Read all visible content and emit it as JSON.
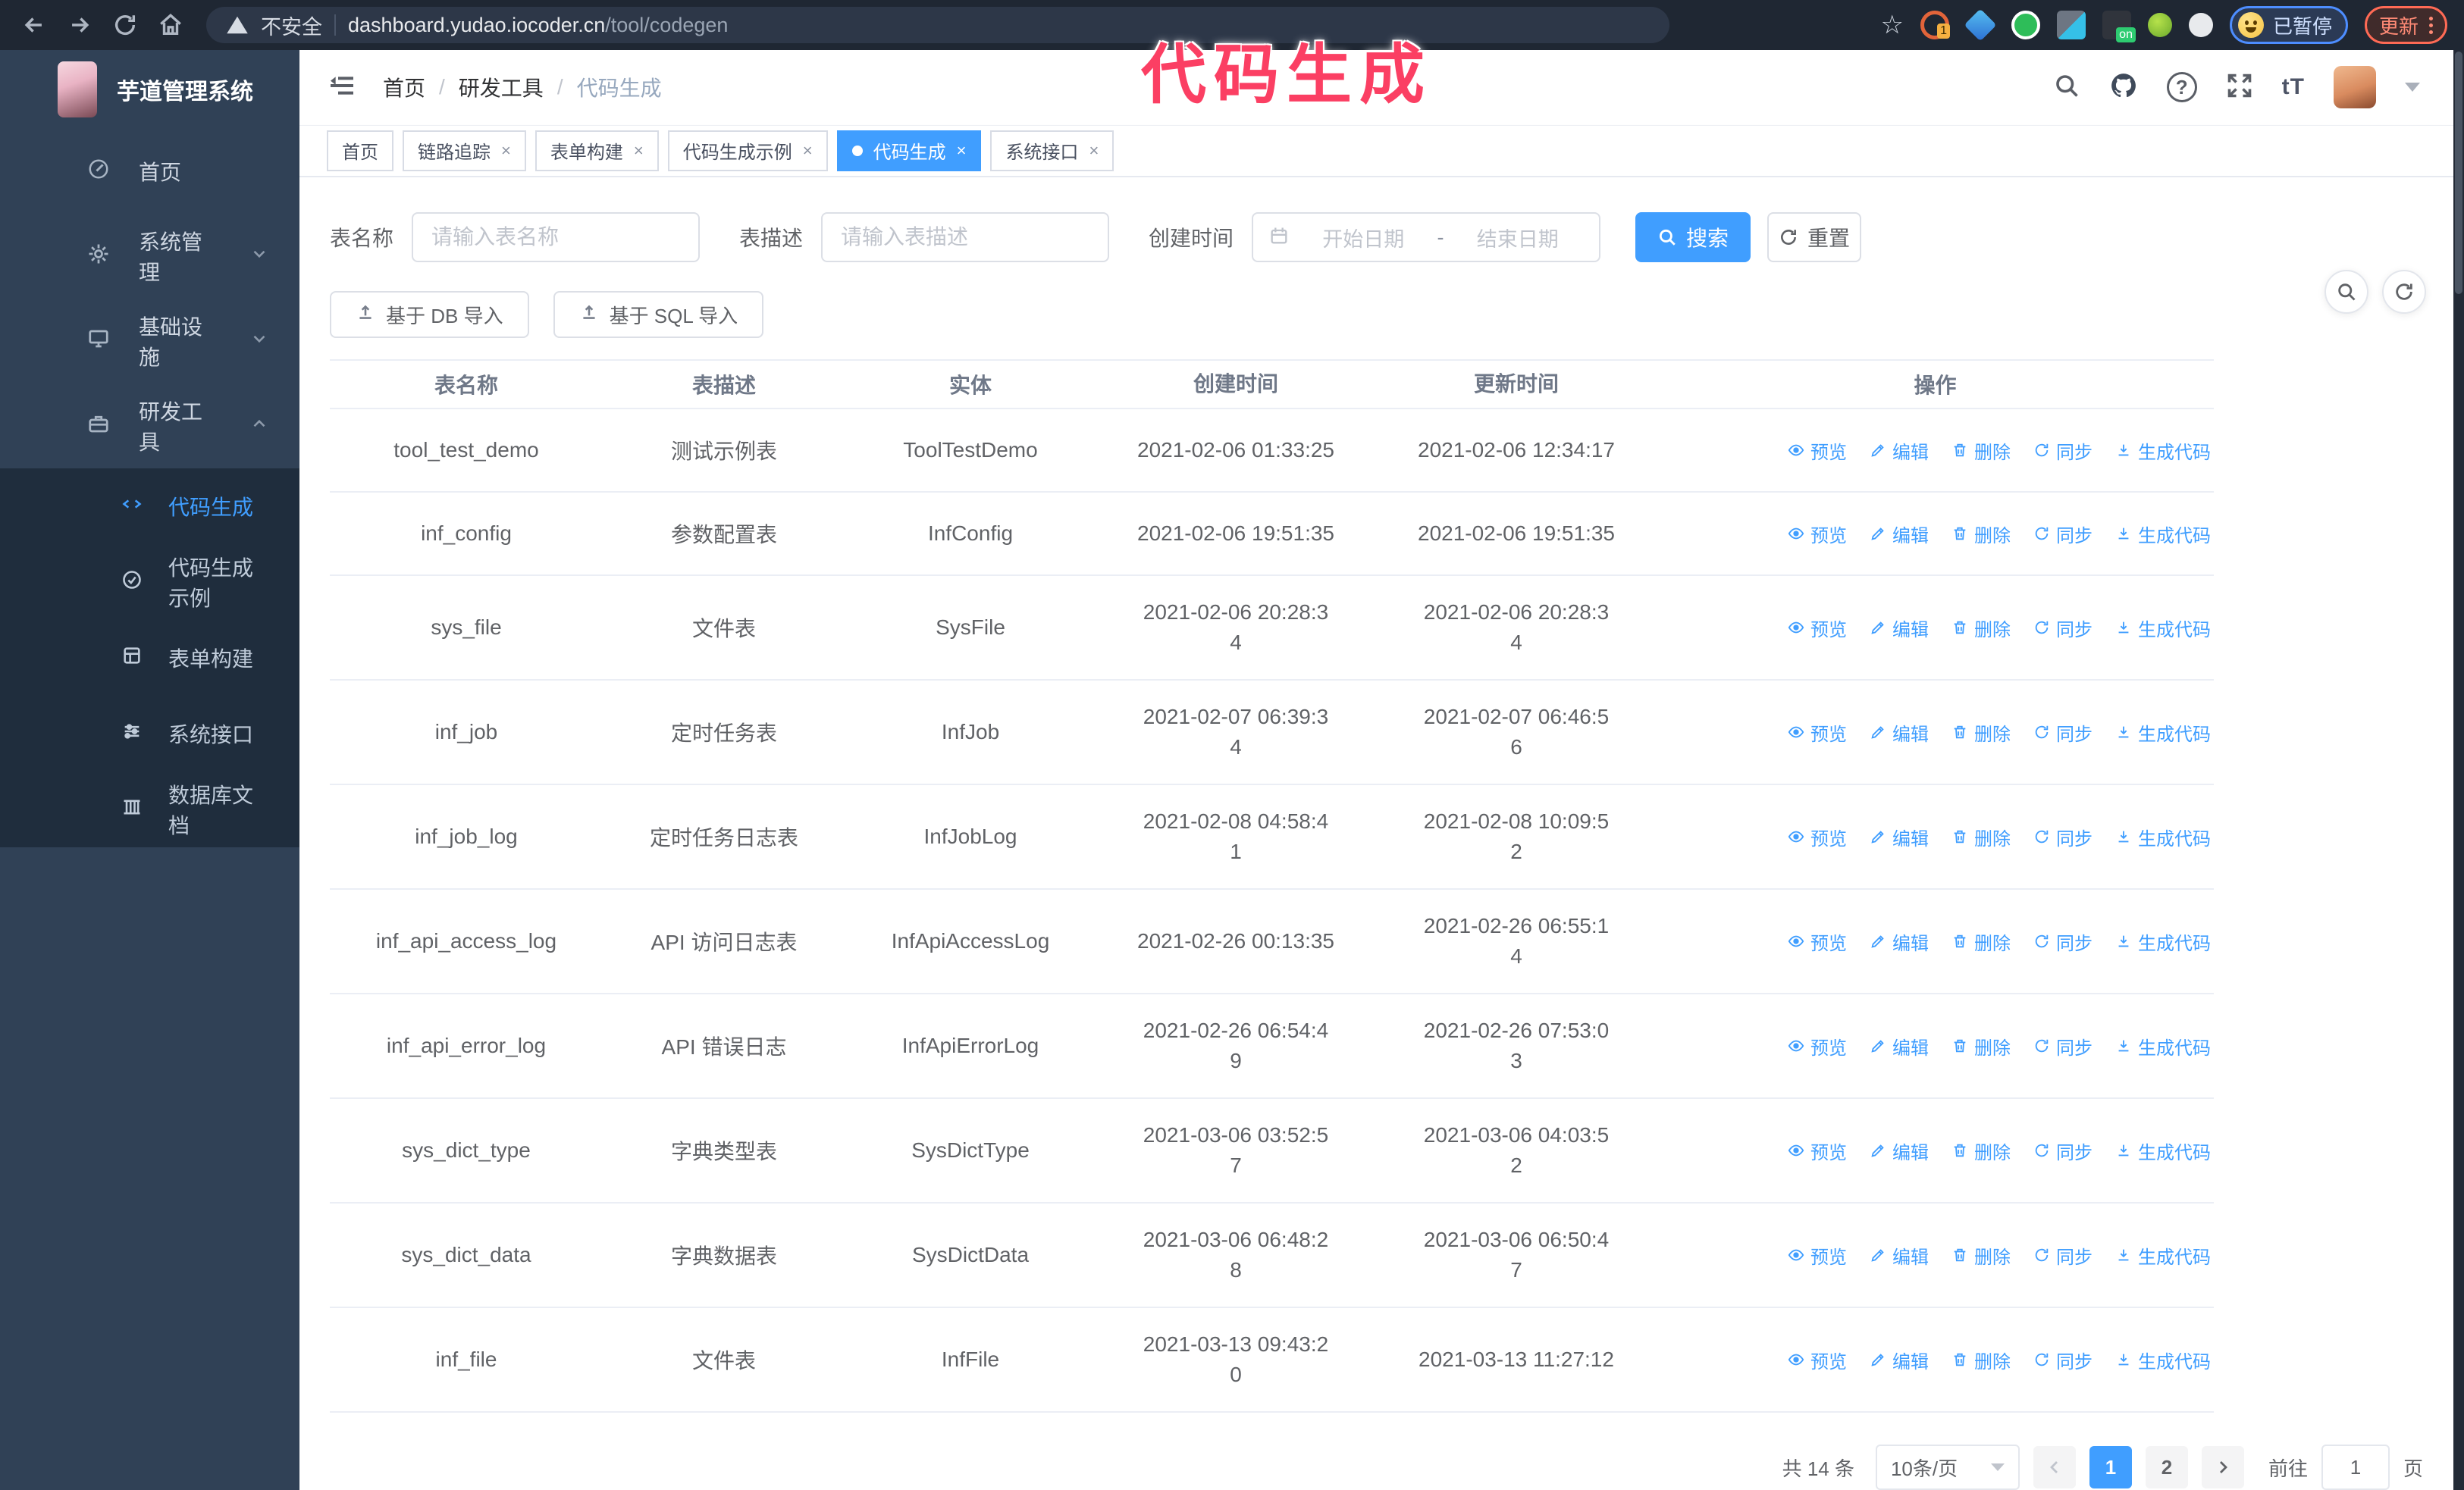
{
  "browser": {
    "security_label": "不安全",
    "url_host": "dashboard.yudao.iocoder.cn",
    "url_path": "/tool/codegen",
    "profile_badge": "已暂停",
    "update_label": "更新"
  },
  "annotation": "代码生成",
  "sidebar": {
    "title": "芋道管理系统",
    "items": [
      {
        "label": "首页"
      },
      {
        "label": "系统管理"
      },
      {
        "label": "基础设施"
      },
      {
        "label": "研发工具"
      }
    ],
    "subitems": [
      {
        "label": "代码生成"
      },
      {
        "label": "代码生成示例"
      },
      {
        "label": "表单构建"
      },
      {
        "label": "系统接口"
      },
      {
        "label": "数据库文档"
      }
    ]
  },
  "breadcrumb": {
    "items": [
      "首页",
      "研发工具",
      "代码生成"
    ],
    "separator": "/"
  },
  "tabs": [
    {
      "label": "首页"
    },
    {
      "label": "链路追踪"
    },
    {
      "label": "表单构建"
    },
    {
      "label": "代码生成示例"
    },
    {
      "label": "代码生成"
    },
    {
      "label": "系统接口"
    }
  ],
  "search": {
    "name_label": "表名称",
    "name_placeholder": "请输入表名称",
    "desc_label": "表描述",
    "desc_placeholder": "请输入表描述",
    "time_label": "创建时间",
    "start_placeholder": "开始日期",
    "range_separator": "-",
    "end_placeholder": "结束日期",
    "search_label": "搜索",
    "reset_label": "重置"
  },
  "toolbar": {
    "import_db_label": "基于 DB 导入",
    "import_sql_label": "基于 SQL 导入"
  },
  "table": {
    "columns": [
      "表名称",
      "表描述",
      "实体",
      "创建时间",
      "更新时间",
      "操作"
    ],
    "action_labels": [
      "预览",
      "编辑",
      "删除",
      "同步",
      "生成代码"
    ],
    "rows": [
      {
        "name": "tool_test_demo",
        "desc": "测试示例表",
        "entity": "ToolTestDemo",
        "created": "2021-02-06 01:33:25",
        "updated": "2021-02-06 12:34:17"
      },
      {
        "name": "inf_config",
        "desc": "参数配置表",
        "entity": "InfConfig",
        "created": "2021-02-06 19:51:35",
        "updated": "2021-02-06 19:51:35"
      },
      {
        "name": "sys_file",
        "desc": "文件表",
        "entity": "SysFile",
        "created": "2021-02-06 20:28:3\n4",
        "updated": "2021-02-06 20:28:3\n4"
      },
      {
        "name": "inf_job",
        "desc": "定时任务表",
        "entity": "InfJob",
        "created": "2021-02-07 06:39:3\n4",
        "updated": "2021-02-07 06:46:5\n6"
      },
      {
        "name": "inf_job_log",
        "desc": "定时任务日志表",
        "entity": "InfJobLog",
        "created": "2021-02-08 04:58:4\n1",
        "updated": "2021-02-08 10:09:5\n2"
      },
      {
        "name": "inf_api_access_log",
        "desc": "API 访问日志表",
        "entity": "InfApiAccessLog",
        "created": "2021-02-26 00:13:35",
        "updated": "2021-02-26 06:55:1\n4"
      },
      {
        "name": "inf_api_error_log",
        "desc": "API 错误日志",
        "entity": "InfApiErrorLog",
        "created": "2021-02-26 06:54:4\n9",
        "updated": "2021-02-26 07:53:0\n3"
      },
      {
        "name": "sys_dict_type",
        "desc": "字典类型表",
        "entity": "SysDictType",
        "created": "2021-03-06 03:52:5\n7",
        "updated": "2021-03-06 04:03:5\n2"
      },
      {
        "name": "sys_dict_data",
        "desc": "字典数据表",
        "entity": "SysDictData",
        "created": "2021-03-06 06:48:2\n8",
        "updated": "2021-03-06 06:50:4\n7"
      },
      {
        "name": "inf_file",
        "desc": "文件表",
        "entity": "InfFile",
        "created": "2021-03-13 09:43:2\n0",
        "updated": "2021-03-13 11:27:12"
      }
    ]
  },
  "pagination": {
    "total_label": "共 14 条",
    "page_size_label": "10条/页",
    "pages": [
      "1",
      "2"
    ],
    "active_page": "1",
    "goto_label": "前往",
    "goto_value": "1",
    "unit_label": "页"
  },
  "colors": {
    "accent": "#409eff",
    "sidebar_bg": "#304156",
    "submenu_bg": "#1f2d3d",
    "tab_active_bg": "#409eff",
    "annotation": "#fb3f63",
    "chrome_bg": "#1f2733"
  }
}
